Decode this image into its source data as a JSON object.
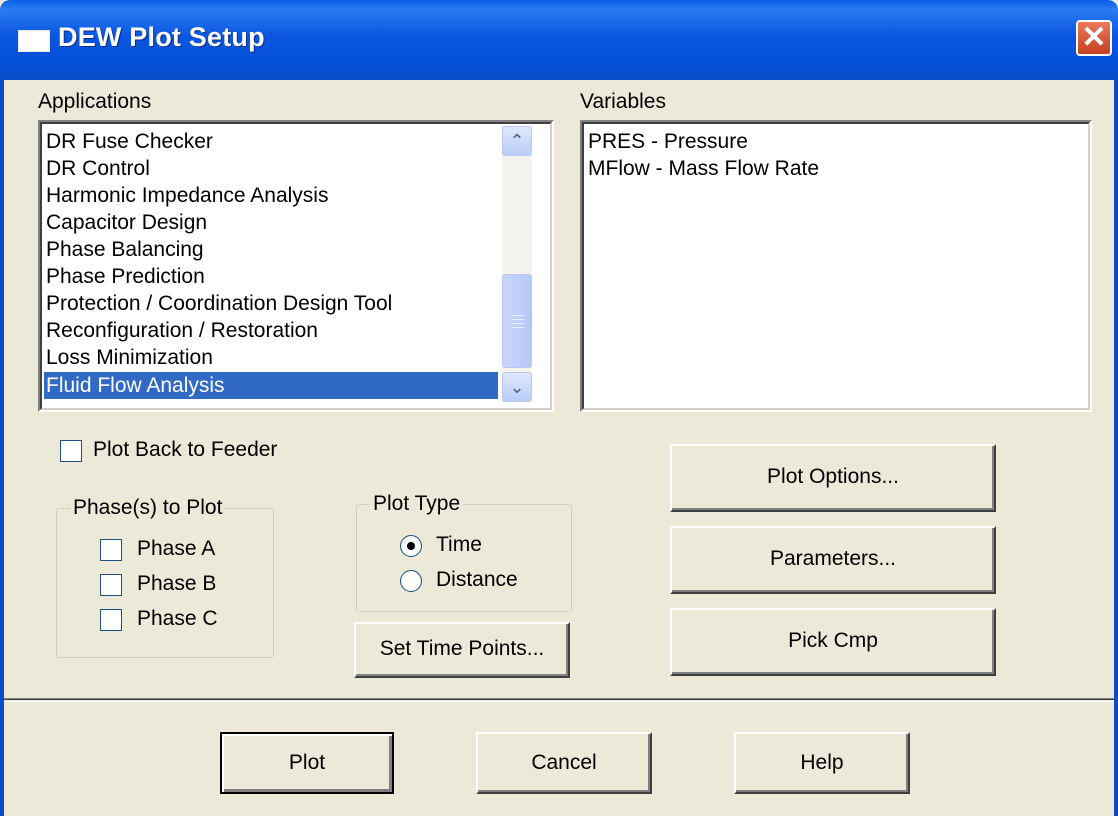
{
  "window": {
    "title": "DEW Plot Setup"
  },
  "applications": {
    "label": "Applications",
    "items": [
      "DR Fuse Checker",
      "DR Control",
      "Harmonic Impedance Analysis",
      "Capacitor Design",
      "Phase Balancing",
      "Phase Prediction",
      "Protection / Coordination Design Tool",
      "Reconfiguration / Restoration",
      "Loss Minimization",
      "Fluid Flow Analysis"
    ],
    "selected": "Fluid Flow Analysis"
  },
  "variables": {
    "label": "Variables",
    "items": [
      "PRES - Pressure",
      "MFlow - Mass Flow Rate"
    ]
  },
  "options": {
    "plot_back_to_feeder": "Plot Back to Feeder"
  },
  "phases": {
    "title": "Phase(s) to Plot",
    "items": [
      "Phase A",
      "Phase B",
      "Phase C"
    ]
  },
  "plot_type": {
    "title": "Plot Type",
    "options": [
      "Time",
      "Distance"
    ],
    "selected": "Time"
  },
  "buttons": {
    "set_time_points": "Set Time Points...",
    "plot_options": "Plot Options...",
    "parameters": "Parameters...",
    "pick_cmp": "Pick Cmp",
    "plot": "Plot",
    "cancel": "Cancel",
    "help": "Help"
  },
  "icons": {
    "close": "close-icon",
    "app": "window-icon",
    "scroll_up": "chevron-up-icon",
    "scroll_down": "chevron-down-icon"
  },
  "colors": {
    "titlebar": "#0a4cc8",
    "selection": "#316ac5",
    "dialog_bg": "#ece9d8",
    "close": "#c5401f"
  }
}
